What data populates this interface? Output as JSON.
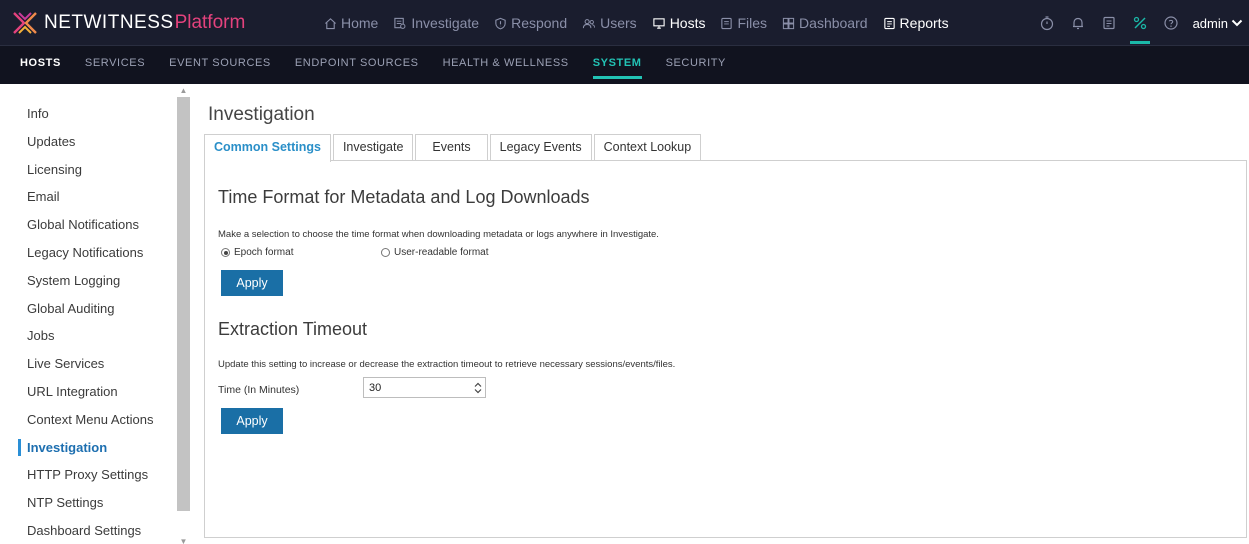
{
  "brand": {
    "name": "NETWITNESS",
    "accent": "Platform",
    "accent_color": "#e4427d"
  },
  "topnav": [
    {
      "label": "Home",
      "icon": "home-icon"
    },
    {
      "label": "Investigate",
      "icon": "investigate-icon"
    },
    {
      "label": "Respond",
      "icon": "respond-icon"
    },
    {
      "label": "Users",
      "icon": "users-icon"
    },
    {
      "label": "Hosts",
      "icon": "hosts-icon",
      "active": true
    },
    {
      "label": "Files",
      "icon": "files-icon"
    },
    {
      "label": "Dashboard",
      "icon": "dashboard-icon"
    },
    {
      "label": "Reports",
      "icon": "reports-icon",
      "active": true
    }
  ],
  "tool_icons": [
    "timer-icon",
    "bell-icon",
    "notes-icon",
    "admin-tools-icon",
    "help-icon"
  ],
  "user": {
    "name": "admin"
  },
  "subnav": [
    {
      "label": "HOSTS"
    },
    {
      "label": "SERVICES"
    },
    {
      "label": "EVENT SOURCES"
    },
    {
      "label": "ENDPOINT SOURCES"
    },
    {
      "label": "HEALTH & WELLNESS"
    },
    {
      "label": "SYSTEM",
      "active": true
    },
    {
      "label": "SECURITY"
    }
  ],
  "sidebar": {
    "items": [
      {
        "label": "Info"
      },
      {
        "label": "Updates"
      },
      {
        "label": "Licensing"
      },
      {
        "label": "Email"
      },
      {
        "label": "Global Notifications"
      },
      {
        "label": "Legacy Notifications"
      },
      {
        "label": "System Logging"
      },
      {
        "label": "Global Auditing"
      },
      {
        "label": "Jobs"
      },
      {
        "label": "Live Services"
      },
      {
        "label": "URL Integration"
      },
      {
        "label": "Context Menu Actions"
      },
      {
        "label": "Investigation",
        "active": true
      },
      {
        "label": "HTTP Proxy Settings"
      },
      {
        "label": "NTP Settings"
      },
      {
        "label": "Dashboard Settings"
      }
    ]
  },
  "page": {
    "title": "Investigation"
  },
  "tabs": [
    {
      "label": "Common Settings",
      "active": true
    },
    {
      "label": "Investigate"
    },
    {
      "label": "Events"
    },
    {
      "label": "Legacy Events"
    },
    {
      "label": "Context Lookup"
    }
  ],
  "time_format": {
    "title": "Time Format for Metadata and Log Downloads",
    "description": "Make a selection to choose the time format when downloading metadata or logs anywhere in Investigate.",
    "options": [
      {
        "label": "Epoch format",
        "selected": true
      },
      {
        "label": "User-readable format",
        "selected": false
      }
    ],
    "apply_label": "Apply"
  },
  "extraction": {
    "title": "Extraction Timeout",
    "description": "Update this setting to increase or decrease the extraction timeout to retrieve necessary sessions/events/files.",
    "field_label": "Time (In Minutes)",
    "value": "30",
    "apply_label": "Apply"
  }
}
